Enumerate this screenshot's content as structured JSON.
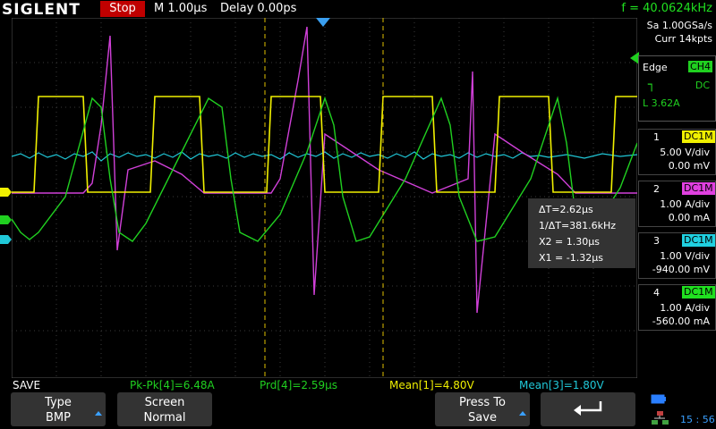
{
  "brand": "SIGLENT",
  "status": "Stop",
  "timebase": "M 1.00µs",
  "delay": "Delay 0.00ps",
  "frequency": "f = 40.0624kHz",
  "sample_rate": "Sa 1.00GSa/s",
  "memory": "Curr 14kpts",
  "trigger": {
    "mode": "Edge",
    "source": "CH4",
    "coupling": "DC",
    "level": "L  3.62A"
  },
  "channels": [
    {
      "num": "1",
      "coupling": "DC1M",
      "scale": "5.00 V/div",
      "offset": "0.00 mV",
      "color": "#ffff00"
    },
    {
      "num": "2",
      "coupling": "DC1M",
      "scale": "1.00 A/div",
      "offset": "0.00 mA",
      "color": "#e040e0"
    },
    {
      "num": "3",
      "coupling": "DC1M",
      "scale": "1.00 V/div",
      "offset": "-940.00 mV",
      "color": "#20d0e0"
    },
    {
      "num": "4",
      "coupling": "DC1M",
      "scale": "1.00 A/div",
      "offset": "-560.00 mA",
      "color": "#20e020"
    }
  ],
  "cursor": {
    "dt": "ΔT=2.62µs",
    "inv_dt": "1/ΔT=381.6kHz",
    "x2": "X2 = 1.30µs",
    "x1": "X1 = -1.32µs"
  },
  "measurements": {
    "save_label": "SAVE",
    "pkpk": "Pk-Pk[4]=6.48A",
    "prd": "Prd[4]=2.59µs",
    "mean1": "Mean[1]=4.80V",
    "mean3": "Mean[3]=1.80V"
  },
  "softkeys": {
    "type_label": "Type",
    "type_value": "BMP",
    "screen_label": "Screen",
    "screen_value": "Normal",
    "press_label": "Press To",
    "press_value": "Save"
  },
  "clock": "15 : 56",
  "colors": {
    "ch1": "#ffff00",
    "ch2": "#e040e0",
    "ch3": "#20d0e0",
    "ch4": "#20e020",
    "stop": "#c00000"
  }
}
